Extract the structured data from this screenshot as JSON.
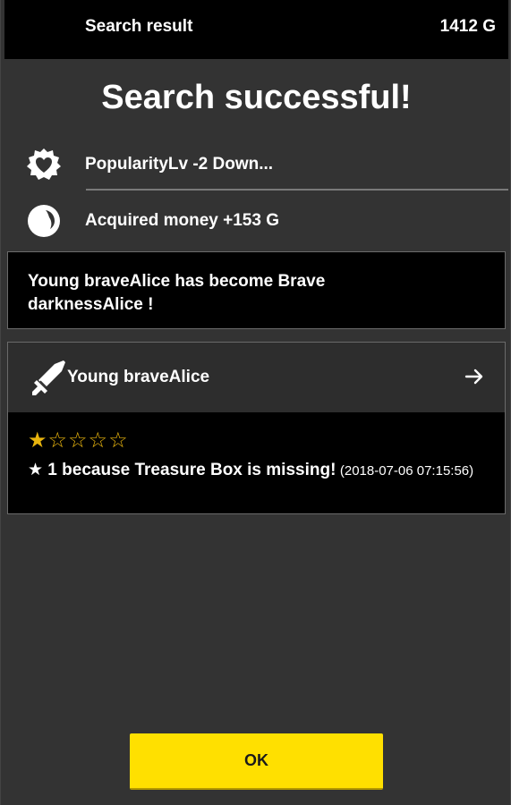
{
  "header": {
    "title": "Search result",
    "money": "1412 G"
  },
  "headline": "Search successful!",
  "results": [
    {
      "icon": "heart-badge-icon",
      "label": "PopularityLv -2 Down..."
    },
    {
      "icon": "coin-icon",
      "label": "Acquired money +153 G"
    }
  ],
  "message": {
    "line1": "Young braveAlice has become Brave",
    "line2": "darknessAlice !"
  },
  "character": {
    "icon": "sword-icon",
    "name": "Young braveAlice",
    "rating": 1,
    "rating_max": 5,
    "review_text": "★ 1 because Treasure Box is missing!",
    "review_date": "(2018-07-06 07:15:56)"
  },
  "ok_label": "OK",
  "colors": {
    "accent": "#ffe000",
    "star": "#e8b40e",
    "background": "#333333",
    "panel": "#000000"
  }
}
